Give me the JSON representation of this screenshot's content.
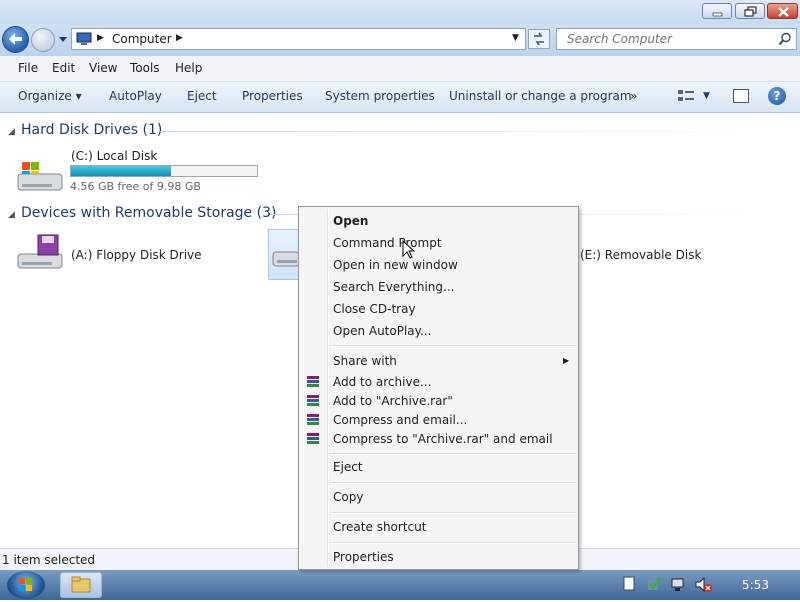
{
  "address": {
    "path": "Computer"
  },
  "search": {
    "placeholder": "Search Computer"
  },
  "menu": [
    "File",
    "Edit",
    "View",
    "Tools",
    "Help"
  ],
  "toolbar": {
    "organize": "Organize ▾",
    "autoplay": "AutoPlay",
    "eject": "Eject",
    "properties": "Properties",
    "system_properties": "System properties",
    "uninstall": "Uninstall or change a program",
    "more": "»"
  },
  "groups": {
    "hard_disk": {
      "title": "Hard Disk Drives (1)"
    },
    "removable": {
      "title": "Devices with Removable Storage (3)"
    }
  },
  "drives": {
    "c": {
      "label": "(C:) Local Disk",
      "free": "4.56 GB free of 9.98 GB",
      "used_fraction": 0.54
    },
    "a": {
      "label": "(A:) Floppy Disk Drive"
    },
    "e": {
      "label": "(E:) Removable Disk"
    }
  },
  "context_menu": {
    "open": "Open",
    "command_prompt": "Command Prompt",
    "open_new_window": "Open in new window",
    "search_everything": "Search Everything...",
    "close_cd_tray": "Close CD-tray",
    "open_autoplay": "Open AutoPlay...",
    "share_with": "Share with",
    "add_to_archive": "Add to archive...",
    "add_to_archive_rar": "Add to \"Archive.rar\"",
    "compress_email": "Compress and email...",
    "compress_rar_email": "Compress to \"Archive.rar\" and email",
    "eject": "Eject",
    "copy": "Copy",
    "create_shortcut": "Create shortcut",
    "properties": "Properties"
  },
  "status": {
    "text": "1 item selected"
  },
  "taskbar": {
    "clock": "5:53"
  }
}
